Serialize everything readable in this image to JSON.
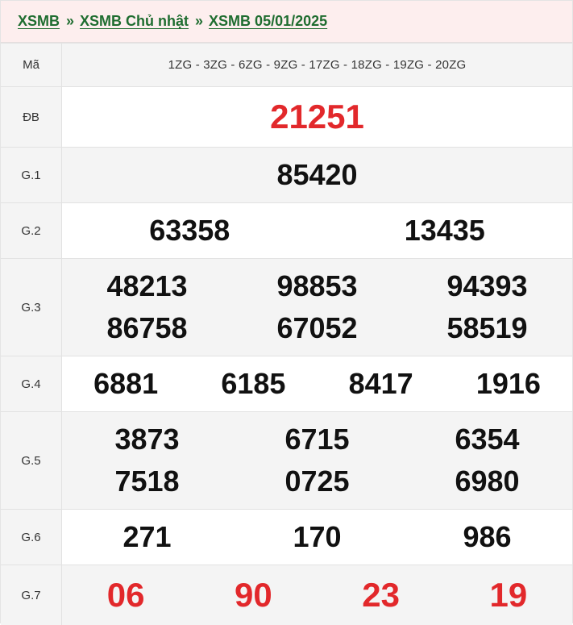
{
  "breadcrumb": {
    "home": "XSMB",
    "sep1": "»",
    "day": "XSMB Chủ nhật",
    "sep2": "»",
    "date": "XSMB 05/01/2025"
  },
  "labels": {
    "ma": "Mã",
    "db": "ĐB",
    "g1": "G.1",
    "g2": "G.2",
    "g3": "G.3",
    "g4": "G.4",
    "g5": "G.5",
    "g6": "G.6",
    "g7": "G.7"
  },
  "codes": "1ZG - 3ZG - 6ZG - 9ZG - 17ZG - 18ZG - 19ZG - 20ZG",
  "prizes": {
    "db": "21251",
    "g1": "85420",
    "g2": [
      "63358",
      "13435"
    ],
    "g3": [
      "48213",
      "98853",
      "94393",
      "86758",
      "67052",
      "58519"
    ],
    "g4": [
      "6881",
      "6185",
      "8417",
      "1916"
    ],
    "g5": [
      "3873",
      "6715",
      "6354",
      "7518",
      "0725",
      "6980"
    ],
    "g6": [
      "271",
      "170",
      "986"
    ],
    "g7": [
      "06",
      "90",
      "23",
      "19"
    ]
  },
  "colors": {
    "breadcrumb_bg": "#fdeeee",
    "breadcrumb_link": "#1f6d30",
    "highlight_red": "#e2282b",
    "label_bg": "#f4f4f4"
  }
}
